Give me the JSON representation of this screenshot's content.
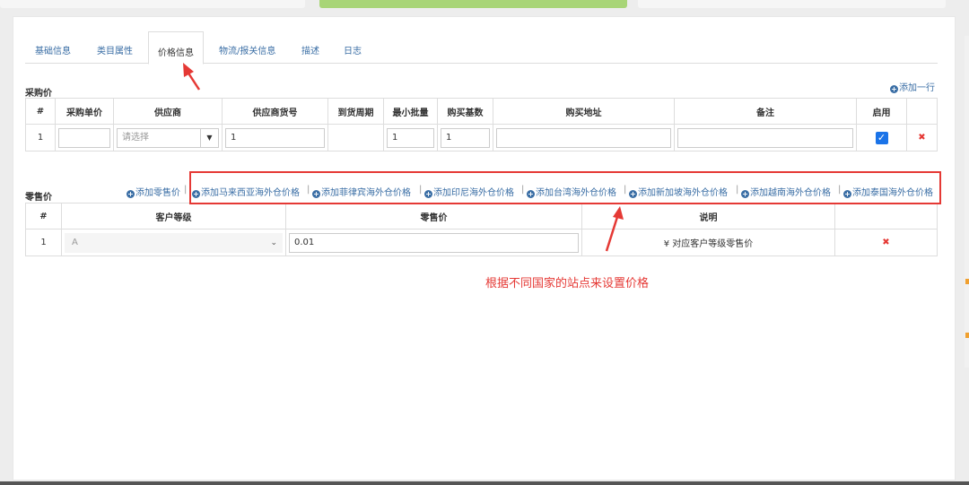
{
  "tabs": [
    "基础信息",
    "类目属性",
    "价格信息",
    "物流/报关信息",
    "描述",
    "日志"
  ],
  "purchase": {
    "title": "采购价",
    "add_row": "添加一行",
    "headers": [
      "#",
      "采购单价",
      "供应商",
      "供应商货号",
      "到货周期",
      "最小批量",
      "购买基数",
      "购买地址",
      "备注",
      "启用",
      ""
    ],
    "row": {
      "index": "1",
      "unit_price": "",
      "supplier_placeholder": "请选择",
      "supplier_sku": "1",
      "lead_time": "",
      "min_qty": "1",
      "base_qty": "1",
      "url": "",
      "remark": "",
      "enabled": true
    }
  },
  "retail": {
    "title": "零售价",
    "add_links": [
      "添加零售价",
      "添加马来西亚海外仓价格",
      "添加菲律宾海外仓价格",
      "添加印尼海外仓价格",
      "添加台湾海外仓价格",
      "添加新加坡海外仓价格",
      "添加越南海外仓价格",
      "添加泰国海外仓价格"
    ],
    "headers": [
      "#",
      "客户等级",
      "零售价",
      "说明",
      ""
    ],
    "row": {
      "index": "1",
      "level": "A",
      "price": "0.01",
      "note": "¥ 对应客户等级零售价"
    }
  },
  "annotation": "根据不同国家的站点来设置价格",
  "colors": {
    "accent": "#3a6ea5",
    "annotation": "#e53935",
    "checkbox": "#1a73e8"
  }
}
